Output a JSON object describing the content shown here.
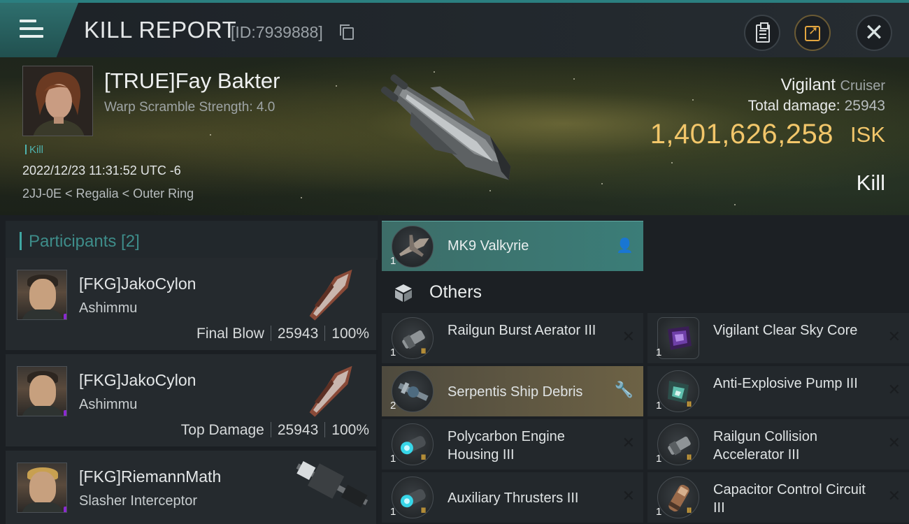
{
  "header": {
    "title": "KILL REPORT",
    "report_id": "[ID:7939888]"
  },
  "victim": {
    "name": "[TRUE]Fay Bakter",
    "warp_scramble": "Warp Scramble Strength: 4.0",
    "tag": "Kill",
    "time": "2022/12/23 11:31:52 UTC -6",
    "location": "2JJ-0E < Regalia < Outer Ring",
    "ship": "Vigilant",
    "ship_class": "Cruiser",
    "total_damage_label": "Total damage:",
    "total_damage": "25943",
    "isk_value": "1,401,626,258",
    "isk_unit": "ISK",
    "result": "Kill"
  },
  "participants": {
    "title": "Participants [2]",
    "list": [
      {
        "name": "[FKG]JakoCylon",
        "ship": "Ashimmu",
        "role": "Final Blow",
        "damage": "25943",
        "percent": "100%"
      },
      {
        "name": "[FKG]JakoCylon",
        "ship": "Ashimmu",
        "role": "Top Damage",
        "damage": "25943",
        "percent": "100%"
      },
      {
        "name": "[FKG]RiemannMath",
        "ship": "Slasher Interceptor"
      }
    ]
  },
  "drone": {
    "qty": "1",
    "name": "MK9  Valkyrie"
  },
  "others_label": "Others",
  "items": [
    {
      "qty": "1",
      "tier": "III",
      "name": "Railgun Burst Aerator III"
    },
    {
      "qty": "1",
      "tier": "",
      "name": "Vigilant Clear Sky Core"
    },
    {
      "qty": "2",
      "tier": "",
      "name": "Serpentis Ship Debris"
    },
    {
      "qty": "1",
      "tier": "III",
      "name": "Anti-Explosive Pump III"
    },
    {
      "qty": "1",
      "tier": "III",
      "name": "Polycarbon Engine Housing III"
    },
    {
      "qty": "1",
      "tier": "III",
      "name": "Railgun Collision Accelerator III"
    },
    {
      "qty": "1",
      "tier": "III",
      "name": "Auxiliary Thrusters III"
    },
    {
      "qty": "1",
      "tier": "III",
      "name": "Capacitor Control Circuit III"
    }
  ],
  "glyphs": {
    "close": "✕",
    "remove": "✕",
    "wrench": "🔧",
    "pilot": "👤",
    "badge": "i"
  },
  "colors": {
    "accent": "#3b7d78",
    "isk": "#f2c66a",
    "highlight": "#6d6245",
    "faction": "#8a2ad0"
  }
}
